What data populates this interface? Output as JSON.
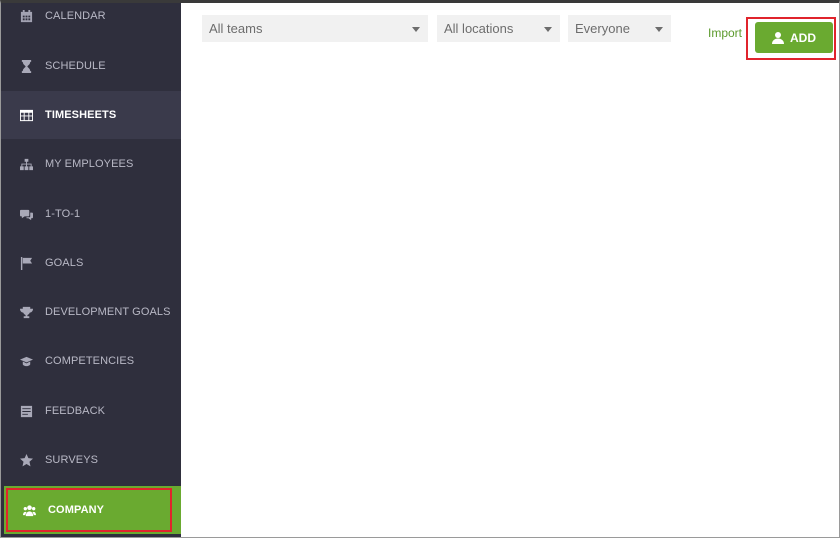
{
  "sidebar": {
    "items": [
      {
        "label": "CALENDAR",
        "icon": "calendar-icon"
      },
      {
        "label": "SCHEDULE",
        "icon": "hourglass-icon"
      },
      {
        "label": "TIMESHEETS",
        "icon": "table-icon",
        "active": true
      },
      {
        "label": "MY EMPLOYEES",
        "icon": "org-chart-icon"
      },
      {
        "label": "1-TO-1",
        "icon": "chat-icon"
      },
      {
        "label": "GOALS",
        "icon": "flag-icon"
      },
      {
        "label": "DEVELOPMENT GOALS",
        "icon": "trophy-icon"
      },
      {
        "label": "COMPETENCIES",
        "icon": "graduation-cap-icon"
      },
      {
        "label": "FEEDBACK",
        "icon": "feedback-icon"
      },
      {
        "label": "SURVEYS",
        "icon": "star-icon"
      },
      {
        "label": "COMPANY",
        "icon": "users-icon",
        "highlighted": true
      }
    ]
  },
  "filters": {
    "teams": "All teams",
    "locations": "All locations",
    "people": "Everyone"
  },
  "toolbar": {
    "import_label": "Import",
    "add_label": "ADD",
    "add_icon": "user-icon"
  },
  "colors": {
    "sidebar_bg": "#2f2f3d",
    "accent_green": "#6aaa30",
    "highlight_red": "#e0242c"
  }
}
